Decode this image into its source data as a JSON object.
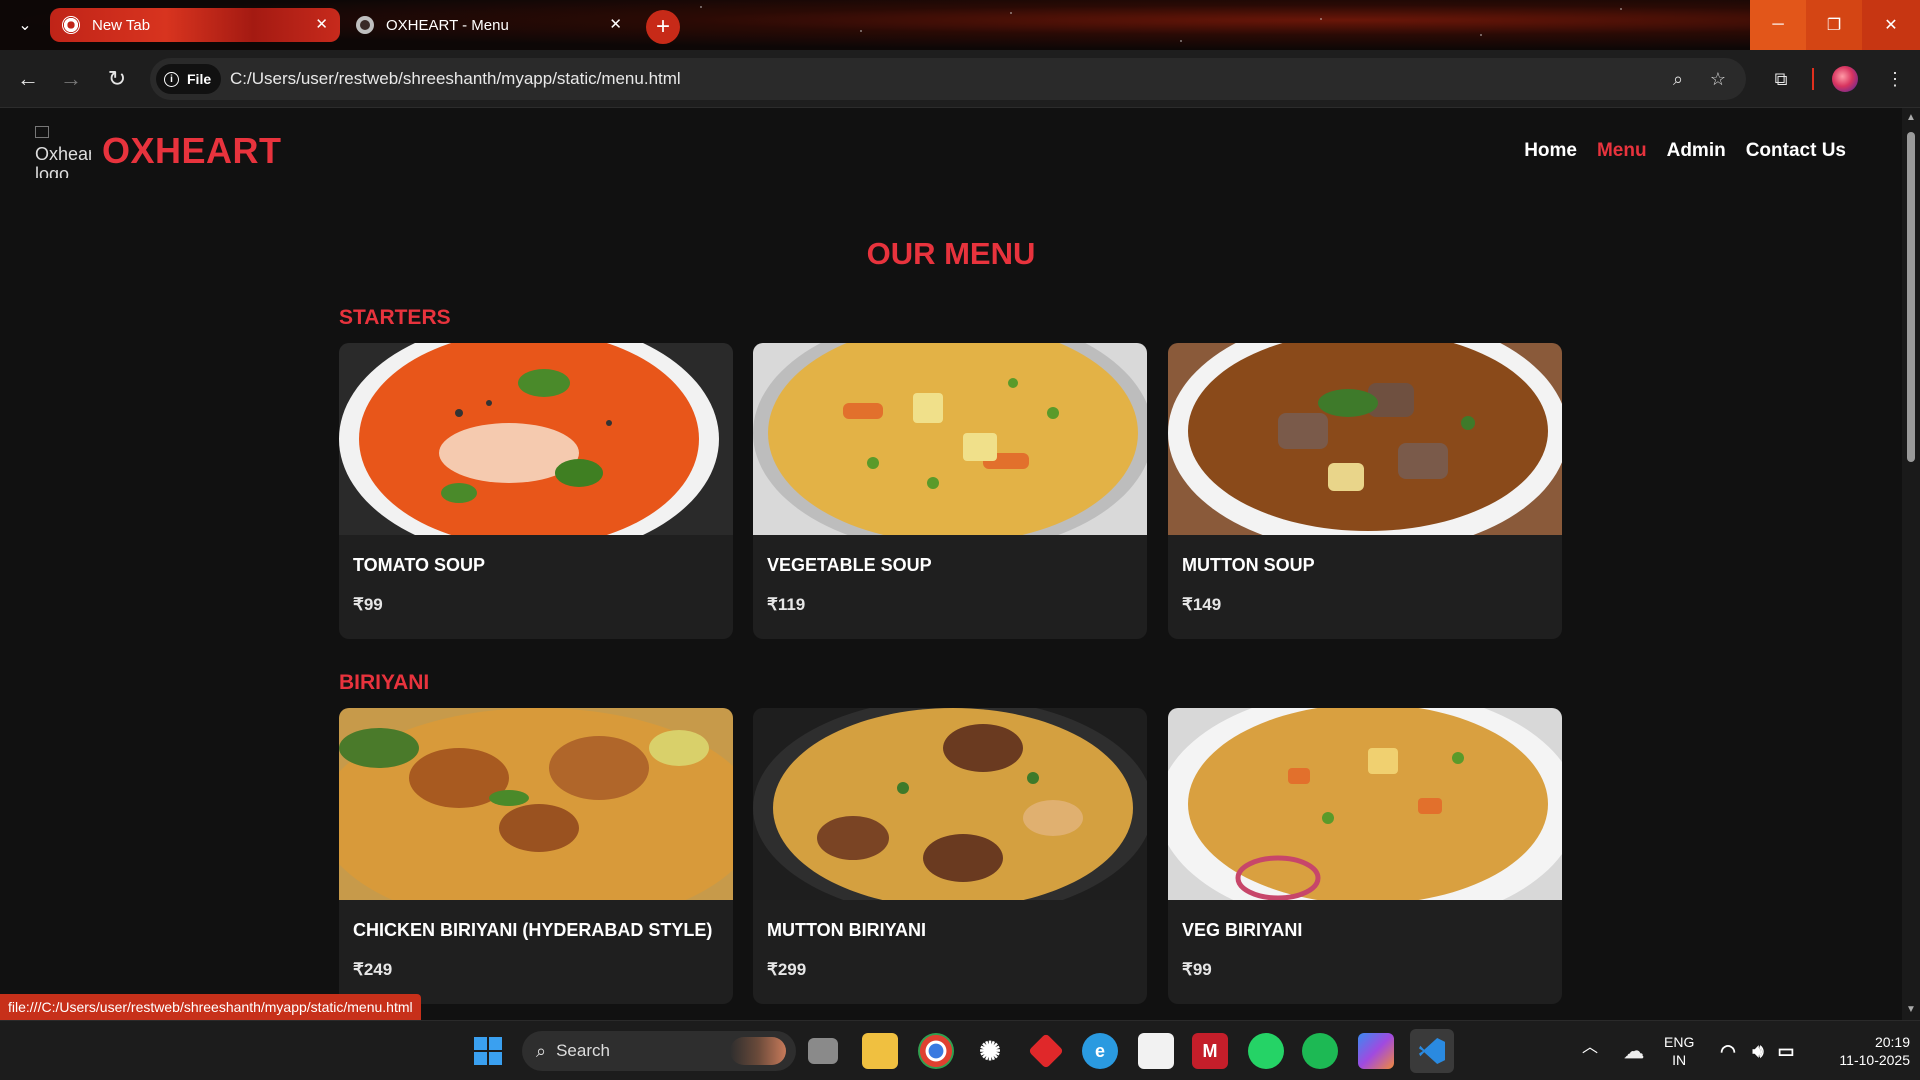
{
  "browser": {
    "tabs": [
      {
        "title": "New Tab",
        "active": false
      },
      {
        "title": "OXHEART - Menu",
        "active": true
      }
    ],
    "address": {
      "chip_label": "File",
      "url": "C:/Users/user/restweb/shreeshanth/myapp/static/menu.html"
    },
    "status_url": "file:///C:/Users/user/restweb/shreeshanth/myapp/static/menu.html"
  },
  "site": {
    "logo_alt": "Oxheart logo",
    "brand": "OXHEART",
    "nav": [
      "Home",
      "Menu",
      "Admin",
      "Contact Us"
    ],
    "active_nav": "Menu",
    "menu_title": "OUR MENU",
    "sections": [
      {
        "title": "STARTERS",
        "items": [
          {
            "name": "TOMATO SOUP",
            "price": "₹99"
          },
          {
            "name": "VEGETABLE SOUP",
            "price": "₹119"
          },
          {
            "name": "MUTTON SOUP",
            "price": "₹149"
          }
        ]
      },
      {
        "title": "BIRIYANI",
        "items": [
          {
            "name": "CHICKEN BIRIYANI (HYDERABAD STYLE)",
            "price": "₹249"
          },
          {
            "name": "MUTTON BIRIYANI",
            "price": "₹299"
          },
          {
            "name": "VEG BIRIYANI",
            "price": "₹99"
          }
        ]
      }
    ]
  },
  "taskbar": {
    "search_label": "Search",
    "language": [
      "ENG",
      "IN"
    ],
    "time": "20:19",
    "date": "11-10-2025"
  },
  "colors": {
    "accent": "#e8333d",
    "card_bg": "#1f1f1f",
    "page_bg": "#111111"
  }
}
